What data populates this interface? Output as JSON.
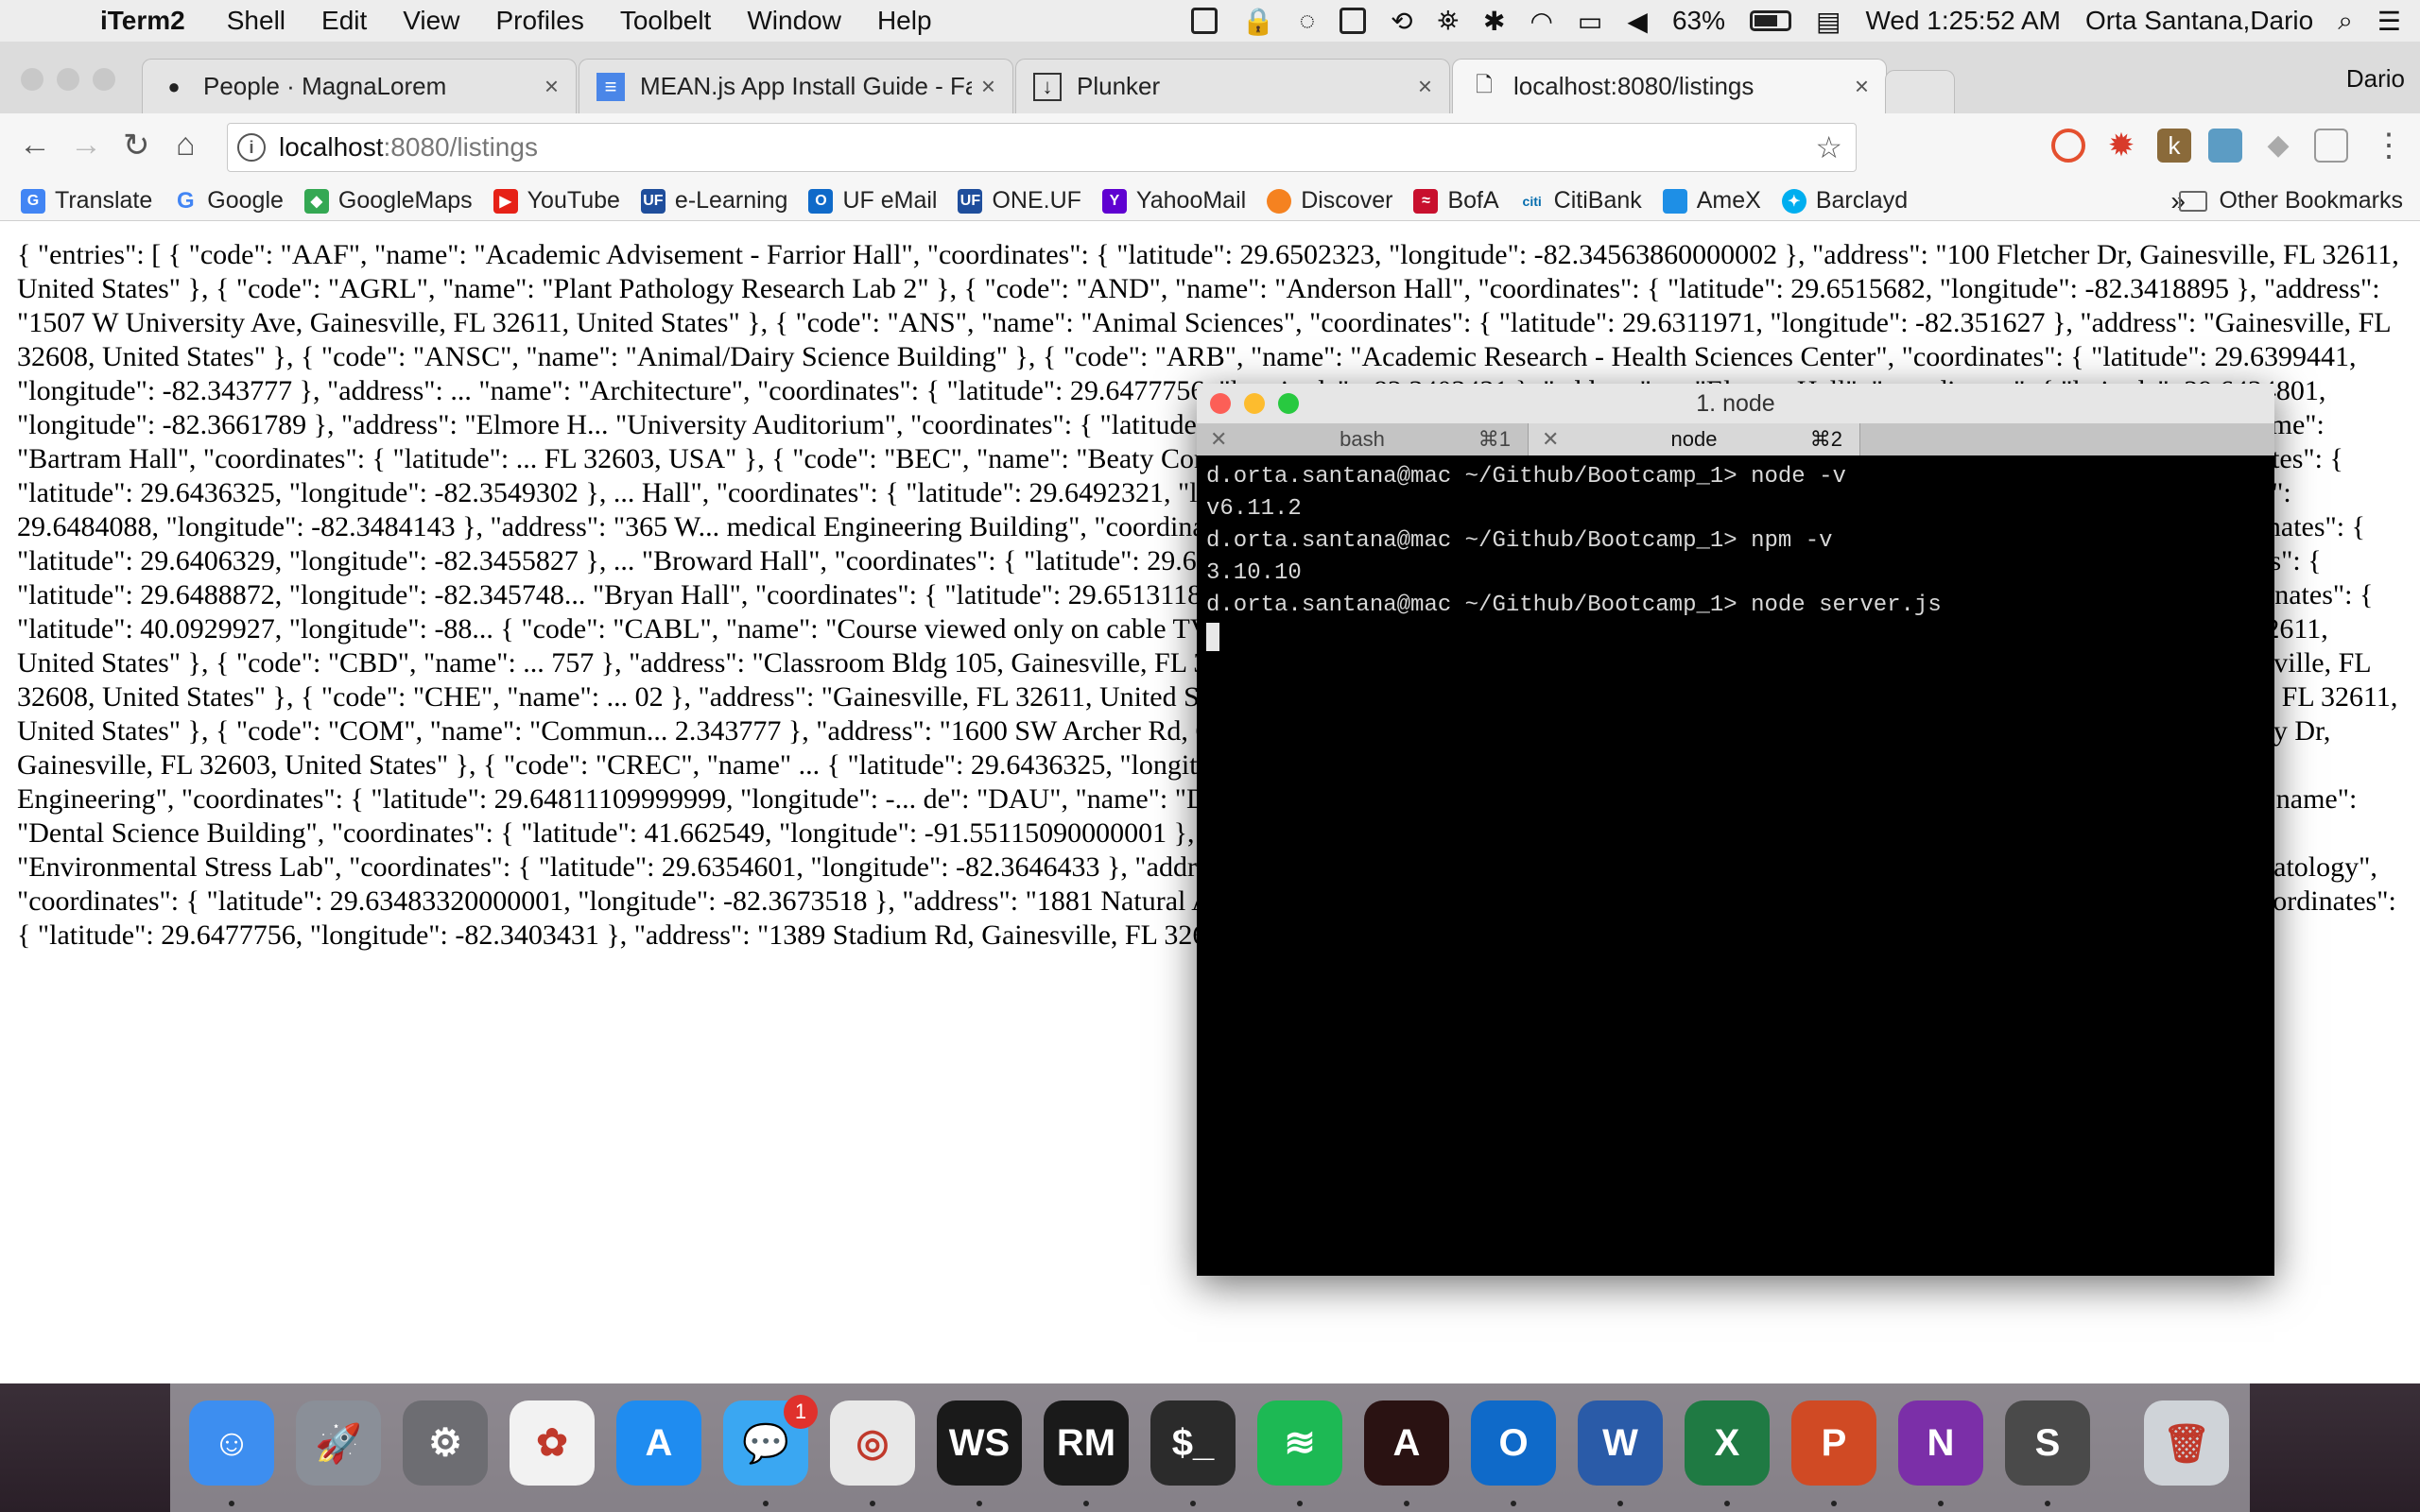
{
  "menubar": {
    "app": "iTerm2",
    "items": [
      "Shell",
      "Edit",
      "View",
      "Profiles",
      "Toolbelt",
      "Window",
      "Help"
    ],
    "battery": "63%",
    "clock": "Wed 1:25:52 AM",
    "user": "Orta Santana,Dario"
  },
  "browser": {
    "profile": "Dario",
    "tabs": [
      {
        "title": "People · MagnaLorem",
        "icon": "github-icon"
      },
      {
        "title": "MEAN.js App Install Guide - Fa",
        "icon": "google-docs-icon"
      },
      {
        "title": "Plunker",
        "icon": "plunker-icon"
      },
      {
        "title": "localhost:8080/listings",
        "icon": "page-icon"
      }
    ],
    "url_host": "localhost",
    "url_path": ":8080/listings",
    "bookmarks": [
      "Translate",
      "Google",
      "GoogleMaps",
      "YouTube",
      "e-Learning",
      "UF eMail",
      "ONE.UF",
      "YahooMail",
      "Discover",
      "BofA",
      "CitiBank",
      "AmeX",
      "Barclayd"
    ],
    "bookmark_more": "»",
    "other_bookmarks": "Other Bookmarks"
  },
  "page": {
    "json_text": "{ \"entries\": [ { \"code\": \"AAF\", \"name\": \"Academic Advisement - Farrior Hall\", \"coordinates\": { \"latitude\": 29.6502323, \"longitude\": -82.34563860000002 }, \"address\": \"100 Fletcher Dr, Gainesville, FL 32611, United States\" }, { \"code\": \"AGRL\", \"name\": \"Plant Pathology Research Lab 2\" }, { \"code\": \"AND\", \"name\": \"Anderson Hall\", \"coordinates\": { \"latitude\": 29.6515682, \"longitude\": -82.3418895 }, \"address\": \"1507 W University Ave, Gainesville, FL 32611, United States\" }, { \"code\": \"ANS\", \"name\": \"Animal Sciences\", \"coordinates\": { \"latitude\": 29.6311971, \"longitude\": -82.351627 }, \"address\": \"Gainesville, FL 32608, United States\" }, { \"code\": \"ANSC\", \"name\": \"Animal/Dairy Science Building\" }, { \"code\": \"ARB\", \"name\": \"Academic Research - Health Sciences Center\", \"coordinates\": { \"latitude\": 29.6399441, \"longitude\": -82.343777 }, \"address\": ... \"name\": \"Architecture\", \"coordinates\": { \"latitude\": 29.6477756, \"longitude\": -82.3403431 }, \"address\": ... \"Elmore Hall\", \"coordinates\": { \"latitude\": 29.6434801, \"longitude\": -82.3661789 }, \"address\": \"Elmore H... \"University Auditorium\", \"coordinates\": { \"latitude\": 29.6490269, \"longitude\": -82.3428428 }, ... \"Aquatic Weed Annex\" }, { \"code\": \"BAR\", \"name\": \"Bartram Hall\", \"coordinates\": { \"latitude\": ... FL 32603, USA\" }, { \"code\": \"BEC\", \"name\": \"Beaty Commons\", \"coordinates\": { \"latitude\": 29.6441511, ... \"BEN\", \"name\": \"Benton Hall\", \"coordinates\": { \"latitude\": 29.6436325, \"longitude\": -82.3549302 }, ... Hall\", \"coordinates\": { \"latitude\": 29.6492321, \"longitude\": -82.3590286 }, \"address\": \"Bruton-Geer Hall ... Science\", \"coordinates\": { \"latitude\": 29.6484088, \"longitude\": -82.3484143 }, \"address\": \"365 W... medical Engineering Building\", \"coordinates\": { \"latitude\": 28.5663939, \"longitude\": -82.3775697 }, ... \"Biomedical Sciences\", \"coordinates\": { \"latitude\": 29.6406329, \"longitude\": -82.3455827 }, ... \"Broward Hall\", \"coordinates\": { \"latitude\": 29.6465352, \"longitude\": -82.3420708 }, \"address\": ... \"Bryant Space Science Center\", \"coordinates\": { \"latitude\": 29.6488872, \"longitude\": -82.345748... \"Bryan Hall\", \"coordinates\": { \"latitude\": 29.65131189999999, \"longitude\": -82.3402381 }, \"addr... \"Veterinary Medicine - Basic Sciences\", \"coordinates\": { \"latitude\": 40.0929927, \"longitude\": -88... { \"code\": \"CABL\", \"name\": \"Course viewed only on cable TV\" }, { \"code\": \"CAR\", \"name\": \"Carl... 0001 }, \"address\": \"1475 Union Rd, Gainesville, FL 32611, United States\" }, { \"code\": \"CBD\", \"name\": ... 757 }, \"address\": \"Classroom Bldg 105, Gainesville, FL 32603, USA\" }, { \"code\": \"CGRC\", \"name\": \"C... 5905 }, \"address\": \"2033 Mowry Rd, Gainesville, FL 32608, United States\" }, { \"code\": \"CHE\", \"name\": ... 02 }, \"address\": \"Gainesville, FL 32611, United States\" }, { \"code\": \"CLB\", \"name\": \"Chemistry Labor... dress\": \"125 Buckman Dr, Gainesville, FL 32611, United States\" }, { \"code\": \"COM\", \"name\": \"Commun... 2.343777 }, \"address\": \"1600 SW Archer Rd, Gainesville, FL 32610, United States\" }, { \"code\": \"CON\", \"n... 482 }, \"address\": \"687 McCarty Dr, Gainesville, FL 32603, United States\" }, { \"code\": \"CREC\", \"name\" ... { \"latitude\": 29.6436325, \"longitude\": -82.3549302 }, \"address\": \"Gainesville, FL 32611, United St... me\": \"Computer Science Engineering\", \"coordinates\": { \"latitude\": 29.64811109999999, \"longitude\": -... de\": \"DAU\", \"name\": \"Dauer Hall - Arts & Sciences\", \"coordinates\": { \"latitude\": 29.64926969999999... de\": \"DSB\", \"name\": \"Dental Science Building\", \"coordinates\": { \"latitude\": 41.662549, \"longitude\": -91.55115090000001 }, \"address\": \"Dental Science Bldg, Iowa City, IA 52242, USA\" }, { \"code\": \"ESL\", \"name\": \"Environmental Stress Lab\", \"coordinates\": { \"latitude\": 29.6354601, \"longitude\": -82.3646433 }, \"address\": \"Gainesville, FL 32608, United States\" }, { \"code\": \"EYN\", \"name\": \"Entomology - Nematology\", \"coordinates\": { \"latitude\": 29.63483320000001, \"longitude\": -82.3673518 }, \"address\": \"1881 Natural Area Dr, Gainesville, FL 32608, United States\" }, { \"code\": \"FAA\", \"name\": \"Fine Arts A\", \"coordinates\": { \"latitude\": 29.6477756, \"longitude\": -82.3403431 }, \"address\": \"1389 Stadium Rd, Gainesville, FL 32611, United States\" }, { \"code\": \"FAB\","
  },
  "terminal": {
    "title": "1. node",
    "tabs": [
      {
        "label": "bash",
        "shortcut": "⌘1"
      },
      {
        "label": "node",
        "shortcut": "⌘2"
      }
    ],
    "lines": [
      "d.orta.santana@mac ~/Github/Bootcamp_1> node -v",
      "v6.11.2",
      "d.orta.santana@mac ~/Github/Bootcamp_1> npm -v",
      "3.10.10",
      "d.orta.santana@mac ~/Github/Bootcamp_1> node server.js"
    ]
  },
  "dock": {
    "messages_badge": "1",
    "apps": [
      {
        "name": "Finder",
        "color": "#3d8ef0",
        "glyph": "☺"
      },
      {
        "name": "Launchpad",
        "color": "#8a8f98",
        "glyph": "🚀"
      },
      {
        "name": "System Preferences",
        "color": "#6d6d72",
        "glyph": "⚙"
      },
      {
        "name": "Photos",
        "color": "#f2f2f2",
        "glyph": "✿"
      },
      {
        "name": "App Store",
        "color": "#1f8cf0",
        "glyph": "A"
      },
      {
        "name": "Messages",
        "color": "#3aa7f2",
        "glyph": "💬"
      },
      {
        "name": "Chrome",
        "color": "#e8e8e8",
        "glyph": "◎"
      },
      {
        "name": "WebStorm",
        "color": "#1a1a1a",
        "glyph": "WS"
      },
      {
        "name": "RubyMine",
        "color": "#1a1a1a",
        "glyph": "RM"
      },
      {
        "name": "Terminal",
        "color": "#2b2b2b",
        "glyph": "$_"
      },
      {
        "name": "Spotify",
        "color": "#1db954",
        "glyph": "≋"
      },
      {
        "name": "Acrobat",
        "color": "#2a1212",
        "glyph": "A"
      },
      {
        "name": "Outlook",
        "color": "#0f6ac9",
        "glyph": "O"
      },
      {
        "name": "Word",
        "color": "#2a5ba8",
        "glyph": "W"
      },
      {
        "name": "Excel",
        "color": "#1f7a43",
        "glyph": "X"
      },
      {
        "name": "PowerPoint",
        "color": "#d04a24",
        "glyph": "P"
      },
      {
        "name": "OneNote",
        "color": "#7b2fa8",
        "glyph": "N"
      },
      {
        "name": "Sublime Text",
        "color": "#4a4a4a",
        "glyph": "S"
      },
      {
        "name": "Trash",
        "color": "#cfd3d8",
        "glyph": "🗑"
      }
    ]
  }
}
